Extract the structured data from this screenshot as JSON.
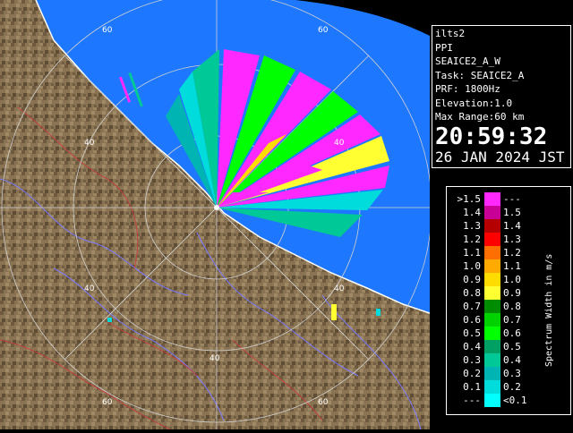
{
  "info": {
    "radar": "ilts2",
    "scan_mode": "PPI",
    "scan_name": "SEAICE2_A_W",
    "task": "Task: SEAICE2_A",
    "prf": "PRF: 1800Hz",
    "elevation": "Elevation:1.0",
    "max_range": "Max Range:60 km",
    "time": "20:59:32",
    "date": "26 JAN 2024 JST"
  },
  "legend": {
    "title": "Spectrum Width in m/s",
    "entries": [
      {
        "lo": ">1.5",
        "hi": "---",
        "color": "#ff28ff"
      },
      {
        "lo": "1.4",
        "hi": "1.5",
        "color": "#c80096"
      },
      {
        "lo": "1.3",
        "hi": "1.4",
        "color": "#b40000"
      },
      {
        "lo": "1.2",
        "hi": "1.3",
        "color": "#ff0000"
      },
      {
        "lo": "1.1",
        "hi": "1.2",
        "color": "#ff6e00"
      },
      {
        "lo": "1.0",
        "hi": "1.1",
        "color": "#ffaa00"
      },
      {
        "lo": "0.9",
        "hi": "1.0",
        "color": "#ffdc00"
      },
      {
        "lo": "0.8",
        "hi": "0.9",
        "color": "#ffff32"
      },
      {
        "lo": "0.7",
        "hi": "0.8",
        "color": "#008c00"
      },
      {
        "lo": "0.6",
        "hi": "0.7",
        "color": "#00d200"
      },
      {
        "lo": "0.5",
        "hi": "0.6",
        "color": "#00ff00"
      },
      {
        "lo": "0.4",
        "hi": "0.5",
        "color": "#00a064"
      },
      {
        "lo": "0.3",
        "hi": "0.4",
        "color": "#00c896"
      },
      {
        "lo": "0.2",
        "hi": "0.3",
        "color": "#00b4b4"
      },
      {
        "lo": "0.1",
        "hi": "0.2",
        "color": "#00dcdc"
      },
      {
        "lo": "---",
        "hi": "<0.1",
        "color": "#00ffff"
      }
    ]
  },
  "range_labels": [
    "60",
    "60",
    "40",
    "40",
    "40",
    "40",
    "40",
    "60",
    "60"
  ],
  "colors": {
    "sea": "#1e78ff",
    "land": "#8a7352",
    "range_ring": "#d0d0d0",
    "coastline": "#ffffff",
    "background": "#000000"
  }
}
